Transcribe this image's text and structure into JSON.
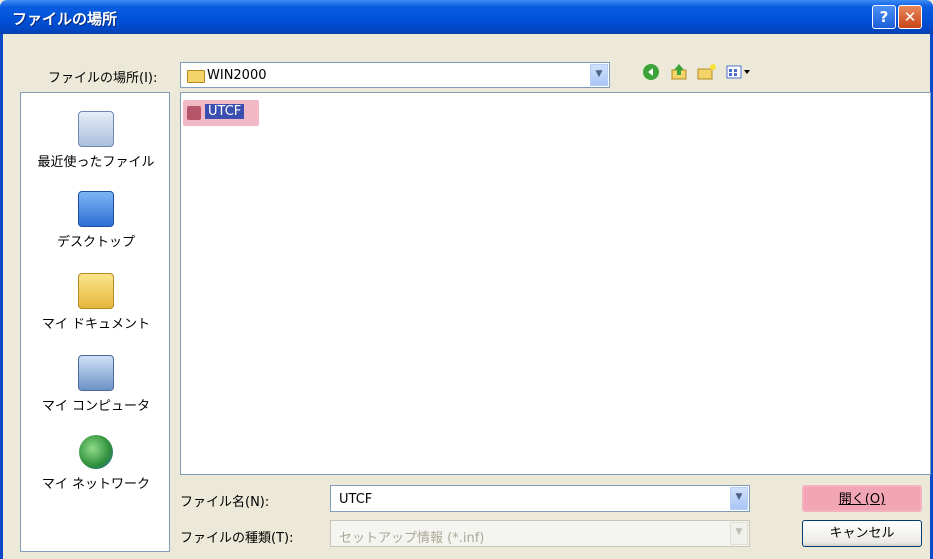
{
  "window": {
    "title": "ファイルの場所",
    "help": "?",
    "close": "✕"
  },
  "lookin": {
    "label": "ファイルの場所(I):",
    "value": "WIN2000"
  },
  "places": [
    {
      "label": "最近使ったファイル"
    },
    {
      "label": "デスクトップ"
    },
    {
      "label": "マイ ドキュメント"
    },
    {
      "label": "マイ コンピュータ"
    },
    {
      "label": "マイ ネットワーク"
    }
  ],
  "files": [
    {
      "name": "UTCF"
    }
  ],
  "filename": {
    "label": "ファイル名(N):",
    "value": "UTCF"
  },
  "filetype": {
    "label": "ファイルの種類(T):",
    "value": "セットアップ情報 (*.inf)"
  },
  "buttons": {
    "open": "開く(O)",
    "cancel": "キャンセル"
  },
  "colors": {
    "titlebar": "#0052d8",
    "selection_highlight": "#f3b8c5"
  }
}
